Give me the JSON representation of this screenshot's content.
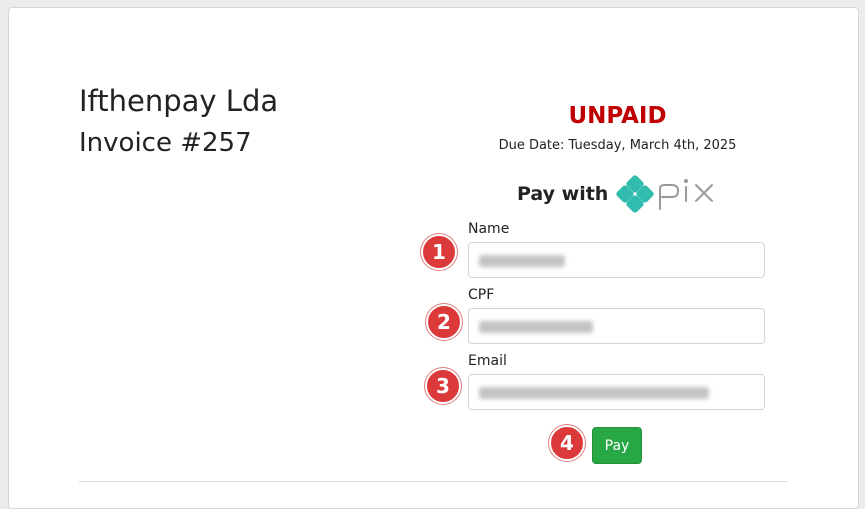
{
  "header": {
    "company": "Ifthenpay Lda",
    "invoice": "Invoice #257"
  },
  "status": {
    "label": "UNPAID",
    "color": "#c00000",
    "due_date": "Due Date: Tuesday, March 4th, 2025"
  },
  "payment": {
    "pay_with": "Pay with",
    "method_logo": "pix"
  },
  "form": {
    "fields": [
      {
        "label": "Name",
        "value": "",
        "step": "1"
      },
      {
        "label": "CPF",
        "value": "",
        "step": "2"
      },
      {
        "label": "Email",
        "value": "",
        "step": "3"
      }
    ],
    "pay_step": "4",
    "pay_label": "Pay"
  },
  "colors": {
    "accent_green": "#28a745",
    "badge_red": "#dc3a3a",
    "pix_teal": "#32bcad"
  }
}
